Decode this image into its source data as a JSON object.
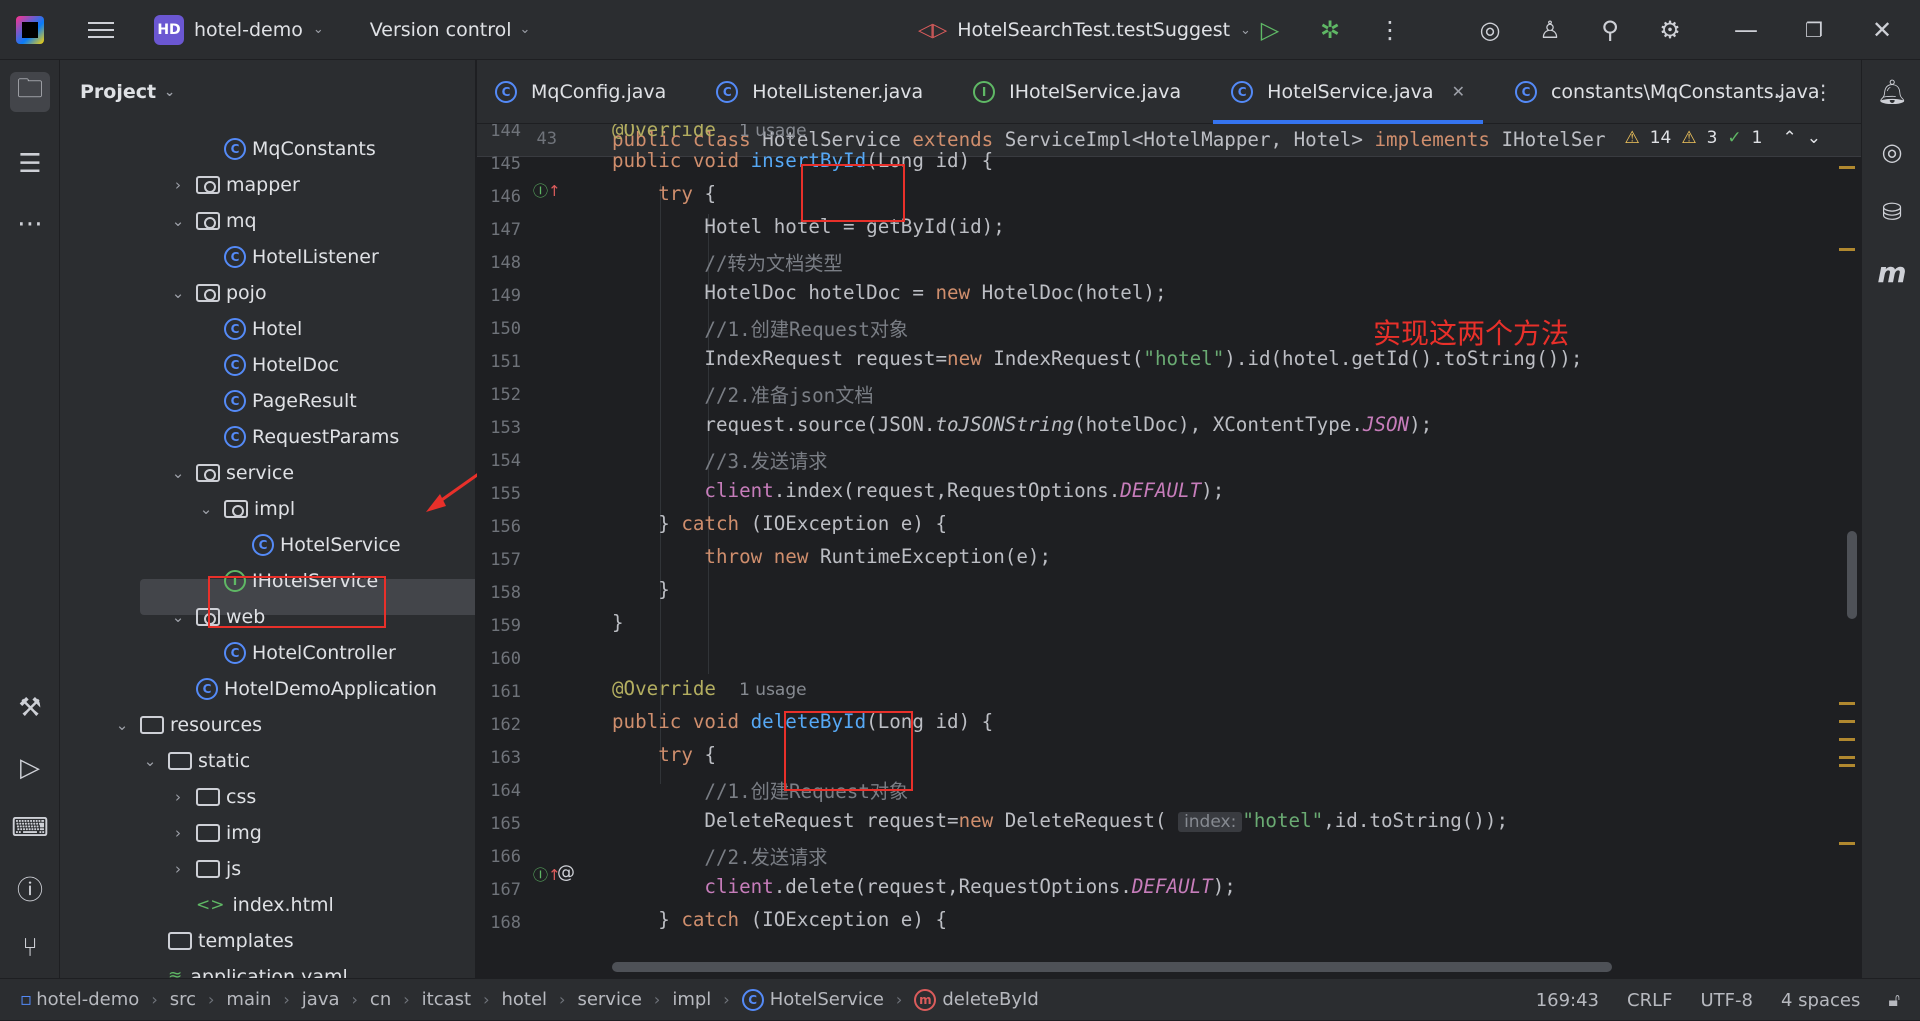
{
  "titlebar": {
    "project_badge": "HD",
    "project_name": "hotel-demo",
    "version_control": "Version control",
    "run_config": "HotelSearchTest.testSuggest"
  },
  "project_panel": {
    "title": "Project",
    "tree": [
      {
        "label": "MqConstants",
        "kind": "class",
        "depth": 5,
        "arrow": ""
      },
      {
        "label": "mapper",
        "kind": "package",
        "depth": 4,
        "arrow": ">"
      },
      {
        "label": "mq",
        "kind": "package",
        "depth": 4,
        "arrow": "v"
      },
      {
        "label": "HotelListener",
        "kind": "class",
        "depth": 5,
        "arrow": ""
      },
      {
        "label": "pojo",
        "kind": "package",
        "depth": 4,
        "arrow": "v"
      },
      {
        "label": "Hotel",
        "kind": "class",
        "depth": 5,
        "arrow": ""
      },
      {
        "label": "HotelDoc",
        "kind": "class",
        "depth": 5,
        "arrow": ""
      },
      {
        "label": "PageResult",
        "kind": "class",
        "depth": 5,
        "arrow": ""
      },
      {
        "label": "RequestParams",
        "kind": "class",
        "depth": 5,
        "arrow": ""
      },
      {
        "label": "service",
        "kind": "package",
        "depth": 4,
        "arrow": "v"
      },
      {
        "label": "impl",
        "kind": "package",
        "depth": 5,
        "arrow": "v"
      },
      {
        "label": "HotelService",
        "kind": "class",
        "depth": 6,
        "arrow": ""
      },
      {
        "label": "IHotelService",
        "kind": "interface",
        "depth": 5,
        "arrow": ""
      },
      {
        "label": "web",
        "kind": "package",
        "depth": 4,
        "arrow": "v"
      },
      {
        "label": "HotelController",
        "kind": "class",
        "depth": 5,
        "arrow": ""
      },
      {
        "label": "HotelDemoApplication",
        "kind": "class",
        "depth": 4,
        "arrow": ""
      },
      {
        "label": "resources",
        "kind": "folder",
        "depth": 2,
        "arrow": "v"
      },
      {
        "label": "static",
        "kind": "folder",
        "depth": 3,
        "arrow": "v"
      },
      {
        "label": "css",
        "kind": "folder",
        "depth": 4,
        "arrow": ">"
      },
      {
        "label": "img",
        "kind": "folder",
        "depth": 4,
        "arrow": ">"
      },
      {
        "label": "js",
        "kind": "folder",
        "depth": 4,
        "arrow": ">"
      },
      {
        "label": "index.html",
        "kind": "html",
        "depth": 4,
        "arrow": ""
      },
      {
        "label": "templates",
        "kind": "folder",
        "depth": 3,
        "arrow": ""
      },
      {
        "label": "application.yaml",
        "kind": "yaml",
        "depth": 3,
        "arrow": ""
      }
    ]
  },
  "tabs": [
    {
      "label": "MqConfig.java",
      "kind": "class"
    },
    {
      "label": "HotelListener.java",
      "kind": "class"
    },
    {
      "label": "IHotelService.java",
      "kind": "interface"
    },
    {
      "label": "HotelService.java",
      "kind": "class",
      "active": true
    },
    {
      "label": "constants\\MqConstants.java",
      "kind": "class"
    }
  ],
  "editor": {
    "sticky_line_number": "43",
    "inspections": {
      "warnings": "14",
      "weak_warnings": "3",
      "ok": "1"
    },
    "annotation_note": "实现这两个方法",
    "line_numbers": [
      "144",
      "145",
      "146",
      "147",
      "148",
      "149",
      "150",
      "151",
      "152",
      "153",
      "154",
      "155",
      "156",
      "157",
      "158",
      "159",
      "160",
      "161",
      "162",
      "163",
      "164",
      "165",
      "166",
      "167",
      "168"
    ],
    "usage_hint": "1 usage",
    "inlay_index": "index:"
  },
  "statusbar": {
    "breadcrumbs": [
      "hotel-demo",
      "src",
      "main",
      "java",
      "cn",
      "itcast",
      "hotel",
      "service",
      "impl",
      "HotelService",
      "deleteById"
    ],
    "position": "169:43",
    "line_ending": "CRLF",
    "encoding": "UTF-8",
    "indent": "4 spaces"
  }
}
